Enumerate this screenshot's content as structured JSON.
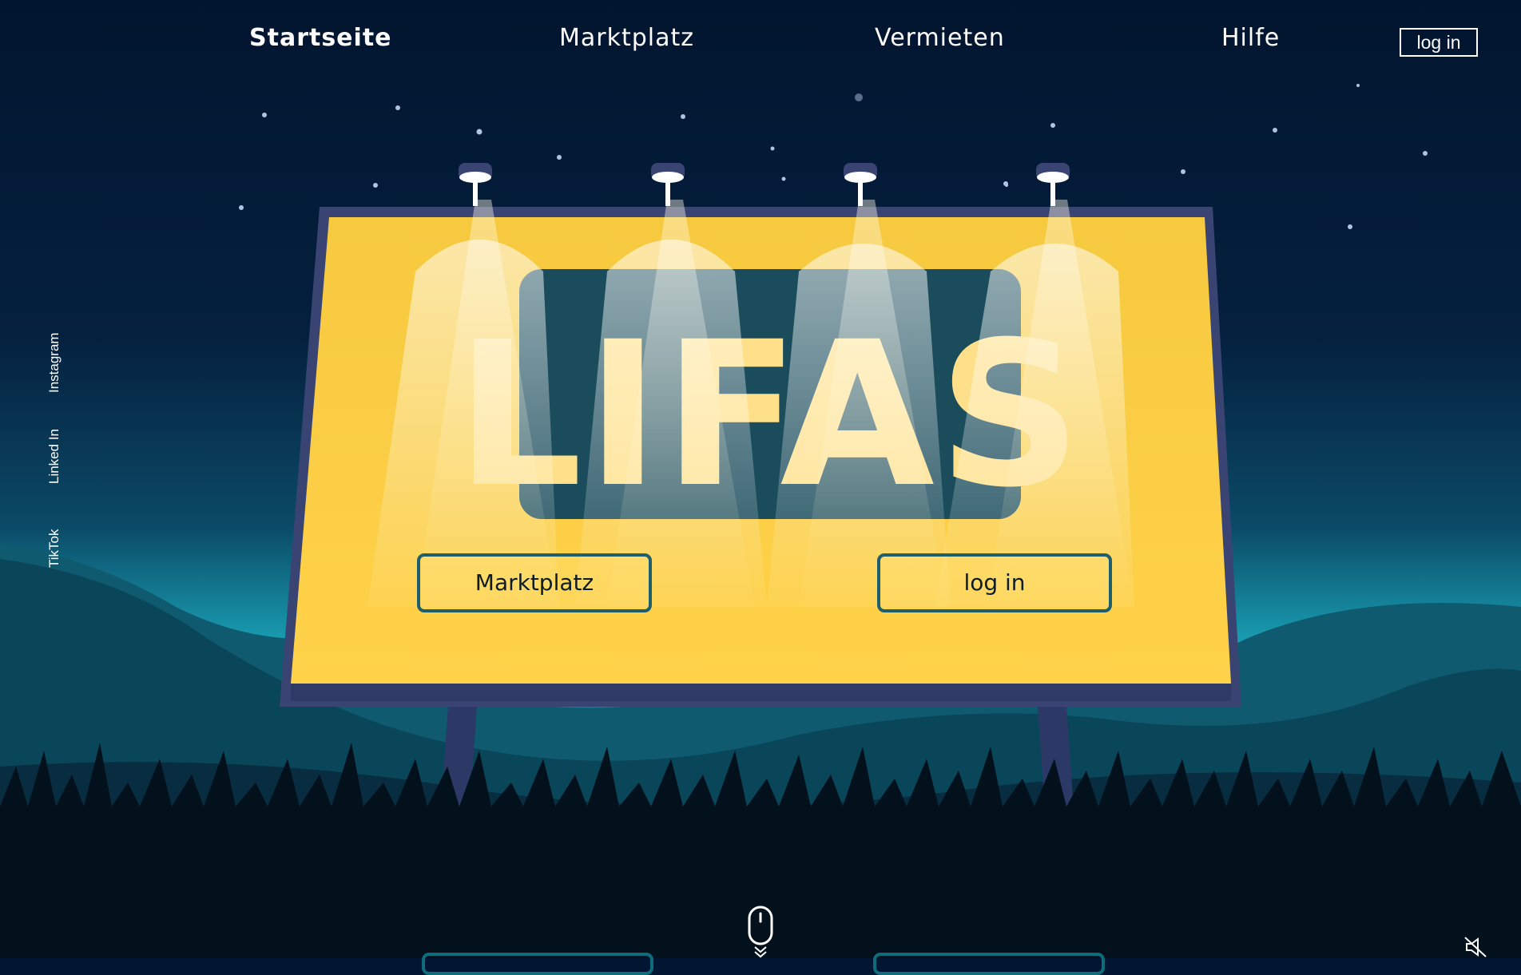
{
  "nav": {
    "items": [
      {
        "label": "Startseite",
        "active": true
      },
      {
        "label": "Marktplatz",
        "active": false
      },
      {
        "label": "Vermieten",
        "active": false
      },
      {
        "label": "Hilfe",
        "active": false
      }
    ],
    "login_label": "log in"
  },
  "social": {
    "instagram": "Instagram",
    "linkedin": "Linked In",
    "tiktok": "TikTok"
  },
  "billboard": {
    "logo": "LIFAS",
    "marketplace_button": "Marktplatz",
    "login_button": "log in"
  },
  "icons": {
    "scroll": "mouse-scroll-icon",
    "sound": "sound-muted-icon"
  },
  "colors": {
    "sky": "#021633",
    "billboard_yellow": "#ffd046",
    "logo_panel": "#1a4c5c",
    "button_border": "#1f5f6c",
    "hills": "#0d6d7c"
  }
}
